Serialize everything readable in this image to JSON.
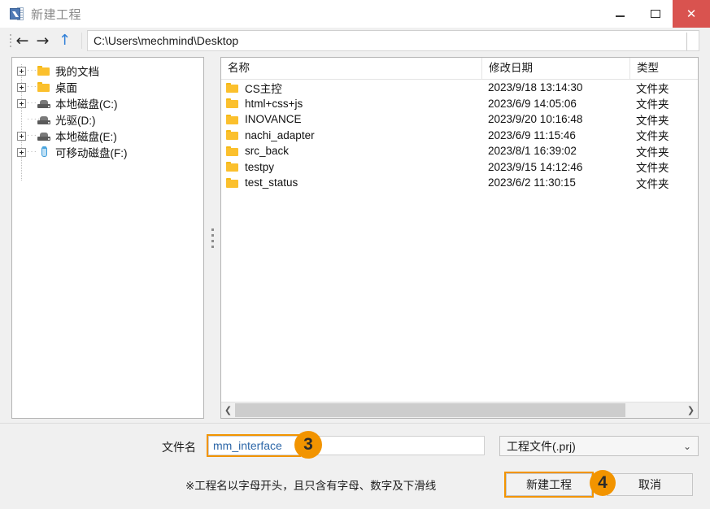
{
  "window": {
    "title": "新建工程",
    "icon": "app-document-icon",
    "controls": {
      "minimize": "–",
      "maximize": "▢",
      "close": "✕"
    }
  },
  "nav": {
    "back_icon": "←",
    "forward_icon": "→",
    "up_icon": "↑",
    "address_value": "C:\\Users\\mechmind\\Desktop",
    "address_placeholder": "路径"
  },
  "tree": {
    "items": [
      {
        "label": "我的文档",
        "icon": "folder-icon",
        "expandable": true
      },
      {
        "label": "桌面",
        "icon": "folder-icon",
        "expandable": true
      },
      {
        "label": "本地磁盘(C:)",
        "icon": "drive-icon",
        "expandable": true
      },
      {
        "label": "光驱(D:)",
        "icon": "drive-icon",
        "expandable": false
      },
      {
        "label": "本地磁盘(E:)",
        "icon": "drive-icon",
        "expandable": true
      },
      {
        "label": "可移动磁盘(F:)",
        "icon": "usb-drive-icon",
        "expandable": true
      }
    ]
  },
  "filelist": {
    "columns": [
      "名称",
      "修改日期",
      "类型"
    ],
    "rows": [
      {
        "name": "CS主控",
        "date": "2023/9/18 13:14:30",
        "type": "文件夹"
      },
      {
        "name": "html+css+js",
        "date": "2023/6/9 14:05:06",
        "type": "文件夹"
      },
      {
        "name": "INOVANCE",
        "date": "2023/9/20 10:16:48",
        "type": "文件夹"
      },
      {
        "name": "nachi_adapter",
        "date": "2023/6/9 11:15:46",
        "type": "文件夹"
      },
      {
        "name": "src_back",
        "date": "2023/8/1 16:39:02",
        "type": "文件夹"
      },
      {
        "name": "testpy",
        "date": "2023/9/15 14:12:46",
        "type": "文件夹"
      },
      {
        "name": "test_status",
        "date": "2023/6/2 11:30:15",
        "type": "文件夹"
      }
    ],
    "scroll_left_icon": "❮",
    "scroll_right_icon": "❯"
  },
  "bottom": {
    "filename_label": "文件名",
    "filename_value": "mm_interface",
    "filename_placeholder": "文件名",
    "filetype_value": "工程文件(.prj)",
    "filetype_chevron": "⌄",
    "hint": "※工程名以字母开头，且只含有字母、数字及下滑线",
    "create_button": "新建工程",
    "cancel_button": "取消"
  },
  "annotations": {
    "badge_filename": "3",
    "badge_create": "4",
    "highlight_color": "#f29400"
  }
}
